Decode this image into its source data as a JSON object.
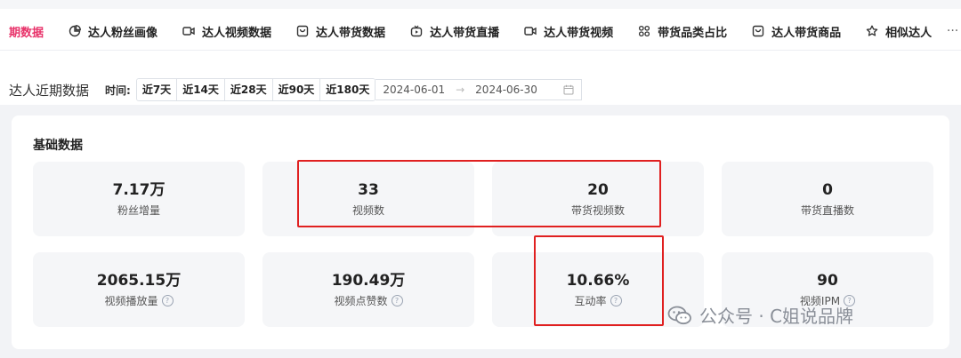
{
  "tabs": [
    {
      "label": "期数据",
      "icon": "none",
      "active": true
    },
    {
      "label": "达人粉丝画像",
      "icon": "pie-chart-icon"
    },
    {
      "label": "达人视频数据",
      "icon": "video-camera-icon"
    },
    {
      "label": "达人带货数据",
      "icon": "shopping-bag-icon"
    },
    {
      "label": "达人带货直播",
      "icon": "live-stream-icon"
    },
    {
      "label": "达人带货视频",
      "icon": "video-camera-icon"
    },
    {
      "label": "带货品类占比",
      "icon": "grid-icon"
    },
    {
      "label": "达人带货商品",
      "icon": "shopping-bag-icon"
    },
    {
      "label": "相似达人",
      "icon": "star-icon"
    }
  ],
  "more_label": "···",
  "filter": {
    "section_title": "达人近期数据",
    "time_label": "时间:",
    "ranges": [
      "近7天",
      "近14天",
      "近28天",
      "近90天",
      "近180天"
    ],
    "start_date": "2024-06-01",
    "end_date": "2024-06-30",
    "arrow": "→"
  },
  "panel": {
    "title": "基础数据",
    "cards": [
      {
        "value": "7.17万",
        "label": "粉丝增量",
        "help": false
      },
      {
        "value": "33",
        "label": "视频数",
        "help": false
      },
      {
        "value": "20",
        "label": "带货视频数",
        "help": false
      },
      {
        "value": "0",
        "label": "带货直播数",
        "help": false
      },
      {
        "value": "2065.15万",
        "label": "视频播放量",
        "help": true
      },
      {
        "value": "190.49万",
        "label": "视频点赞数",
        "help": true
      },
      {
        "value": "10.66%",
        "label": "互动率",
        "help": true
      },
      {
        "value": "90",
        "label": "视频IPM",
        "help": true
      }
    ],
    "help_glyph": "?"
  },
  "watermark": {
    "text": "公众号 · C姐说品牌"
  },
  "colors": {
    "accent": "#e8336a",
    "highlight": "#e02020",
    "card_bg": "#f5f6f8"
  }
}
